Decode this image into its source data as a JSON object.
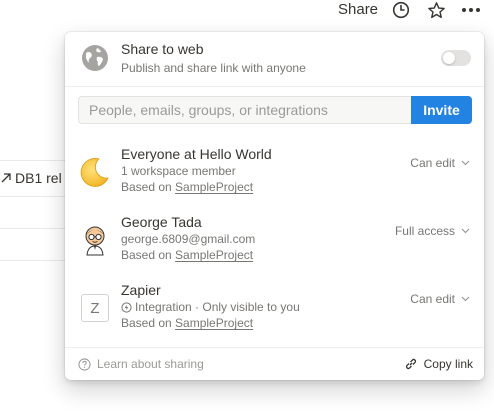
{
  "topbar": {
    "share_label": "Share",
    "icons": [
      "clock-icon",
      "star-icon",
      "more-icon"
    ]
  },
  "background": {
    "db_ref_label": "DB1 rel"
  },
  "share_to_web": {
    "title": "Share to web",
    "subtitle": "Publish and share link with anyone",
    "toggle_on": false
  },
  "invite": {
    "placeholder": "People, emails, groups, or integrations",
    "button_label": "Invite"
  },
  "members": [
    {
      "name": "Everyone at Hello World",
      "detail": "1 workspace member",
      "based_on_prefix": "Based on ",
      "based_on_project": "SampleProject",
      "permission": "Can edit",
      "avatar": "moon-icon"
    },
    {
      "name": "George Tada",
      "detail": "george.6809@gmail.com",
      "based_on_prefix": "Based on ",
      "based_on_project": "SampleProject",
      "permission": "Full access",
      "avatar": "person-avatar"
    },
    {
      "name": "Zapier",
      "detail": "Integration · Only visible to you",
      "based_on_prefix": "Based on ",
      "based_on_project": "SampleProject",
      "permission": "Can edit",
      "avatar_letter": "Z"
    }
  ],
  "footer": {
    "learn_label": "Learn about sharing",
    "copy_label": "Copy link"
  },
  "colors": {
    "accent": "#2383e2",
    "text": "#37352f",
    "muted": "#787774"
  }
}
